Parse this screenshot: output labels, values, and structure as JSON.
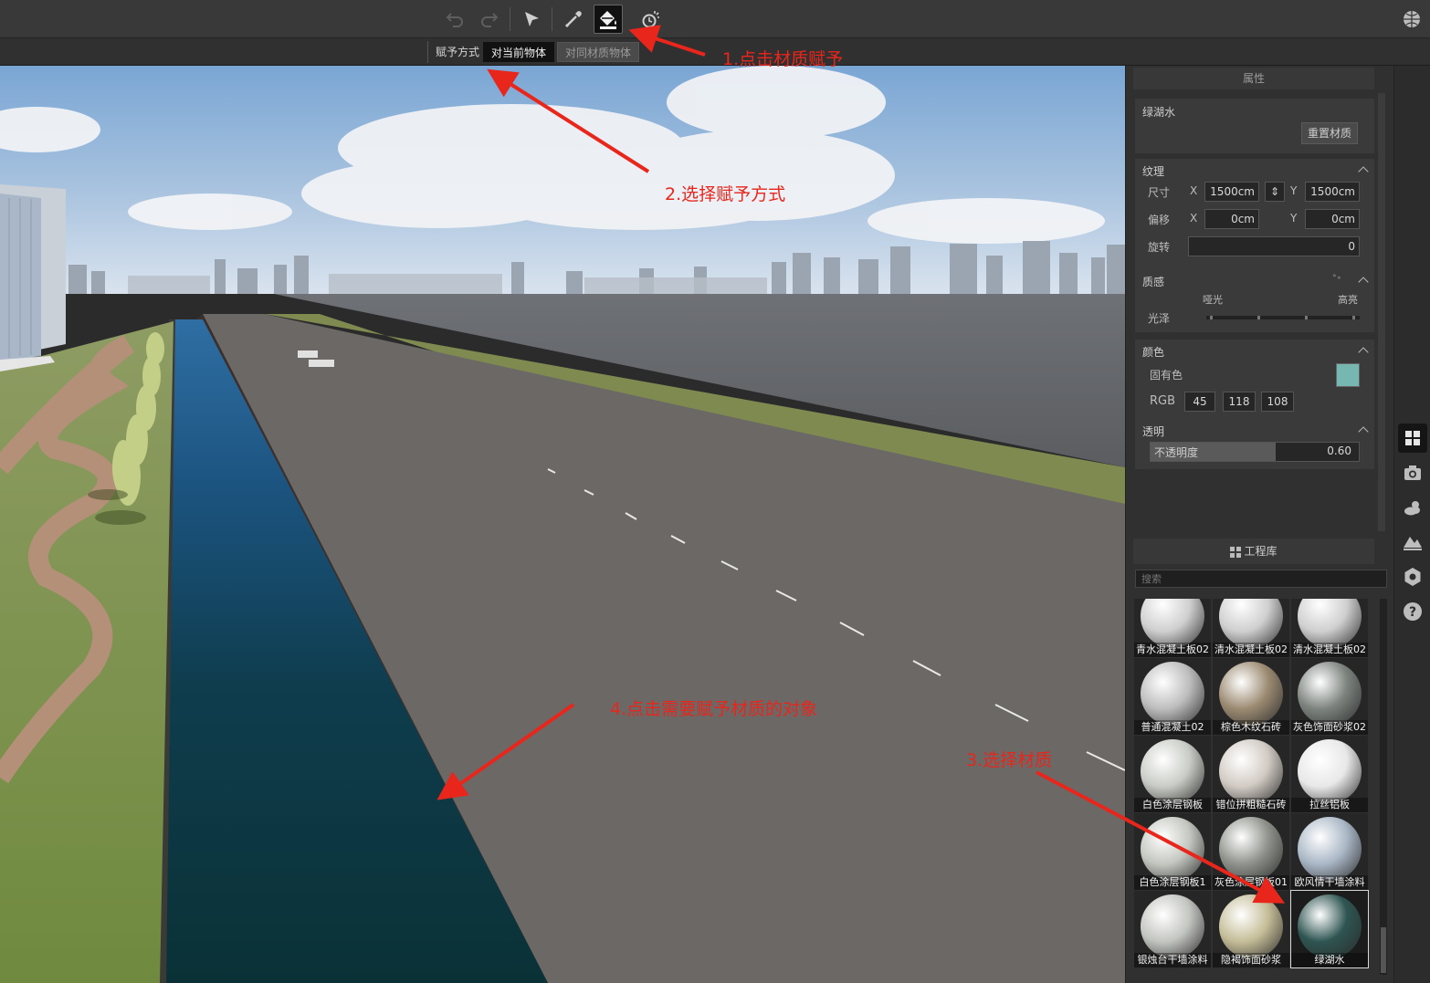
{
  "toolbar": {
    "tools": [
      "undo-icon",
      "redo-icon",
      "select-arrow-icon",
      "eyedropper-icon",
      "paint-bucket-icon",
      "sun-time-icon"
    ],
    "right_icon": "globe-icon"
  },
  "assign_mode": {
    "label": "赋予方式",
    "options": [
      "对当前物体",
      "对同材质物体"
    ],
    "selected": "对当前物体"
  },
  "properties": {
    "header": "属性",
    "material_name": "绿湖水",
    "reset_button": "重置材质",
    "texture": {
      "title": "纹理",
      "size_label": "尺寸",
      "size_x": "1500cm",
      "size_y": "1500cm",
      "offset_label": "偏移",
      "offset_x": "0cm",
      "offset_y": "0cm",
      "rotate_label": "旋转",
      "rotate_value": "0",
      "x": "X",
      "y": "Y"
    },
    "quality": {
      "title": "质感",
      "matte": "哑光",
      "glossy": "高亮",
      "gloss_label": "光泽"
    },
    "color": {
      "title": "颜色",
      "intrinsic_label": "固有色",
      "swatch": "#76b8b1",
      "rgb_label": "RGB",
      "r": "45",
      "g": "118",
      "b": "108"
    },
    "transparency": {
      "title": "透明",
      "opacity_label": "不透明度",
      "opacity_value": "0.60",
      "opacity_fraction": 0.6
    }
  },
  "library": {
    "header": "工程库",
    "search_placeholder": "搜索",
    "materials": [
      {
        "name": "青水混凝土板02",
        "tone": "#cfcfcf"
      },
      {
        "name": "清水混凝土板02",
        "tone": "#cfcfcf"
      },
      {
        "name": "清水混凝土板02",
        "tone": "#cfcfcf"
      },
      {
        "name": "普通混凝土02",
        "tone": "#bdbdbd"
      },
      {
        "name": "棕色木纹石砖",
        "tone": "#9c8b72"
      },
      {
        "name": "灰色饰面砂浆02",
        "tone": "#7d837f"
      },
      {
        "name": "白色涂层钢板",
        "tone": "#c9ccc6"
      },
      {
        "name": "错位拼粗糙石砖",
        "tone": "#d2cbc4"
      },
      {
        "name": "拉丝铝板",
        "tone": "#e8e8e8"
      },
      {
        "name": "白色涂层钢板1",
        "tone": "#c4c7c0"
      },
      {
        "name": "灰色涂层钢板01",
        "tone": "#8f938c"
      },
      {
        "name": "欧风情干墙涂料",
        "tone": "#aab7c6"
      },
      {
        "name": "银烛台干墙涂料",
        "tone": "#c3c5c1"
      },
      {
        "name": "隐褐饰面砂浆",
        "tone": "#c5bd98"
      },
      {
        "name": "绿湖水",
        "tone": "#2e5552"
      }
    ],
    "selected_index": 14
  },
  "side_icons": [
    "grid-icon",
    "camera-icon",
    "weather-icon",
    "terrain-icon",
    "settings-icon",
    "help-icon"
  ],
  "annotations": {
    "step1": "1.点击材质赋予",
    "step2": "2.选择赋予方式",
    "step3": "3.选择材质",
    "step4": "4.点击需要赋予材质的对象"
  },
  "colors": {
    "annotation": "#e8261c",
    "water": "#123b45",
    "road": "#6b6866",
    "grass": "#7f8f4e"
  }
}
